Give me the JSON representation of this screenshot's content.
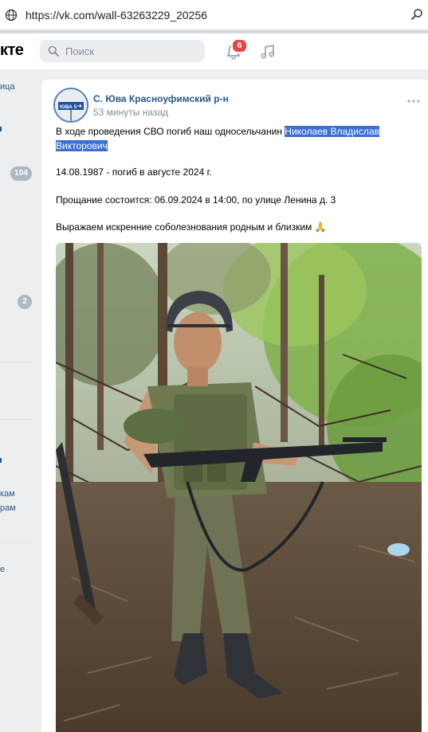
{
  "browser": {
    "url": "https://vk.com/wall-63263229_20256",
    "globe_icon": "globe-icon",
    "zoom_icon": "zoom-icon"
  },
  "header": {
    "logo": "кте",
    "search_placeholder": "Поиск",
    "notifications_count": "6"
  },
  "sidebar": {
    "items": [
      {
        "label": "ица"
      },
      {
        "label": "кам"
      },
      {
        "label": "рам"
      },
      {
        "label": "е"
      }
    ],
    "counts": [
      "104",
      "2"
    ]
  },
  "post": {
    "author": "С. Юва Красноуфимский р-н",
    "time": "53 минуты назад",
    "avatar_text": "ЮВА 5",
    "line1_prefix": "В ходе проведения СВО погиб наш односельчанин ",
    "line1_name": "Николаев Владислав",
    "line2_name": "Викторович",
    "line3": "14.08.1987 - погиб в августе 2024 г.",
    "line4": "Прощание состоится: 06.09.2024 в 14:00, по улице Ленина д. 3",
    "line5": "Выражаем искренние соболезнования родным и близким",
    "emoji": "🙏"
  },
  "colors": {
    "link": "#2a5885",
    "highlight": "#3b6fd6",
    "badge": "#e64646",
    "page_bg": "#edeef0"
  }
}
